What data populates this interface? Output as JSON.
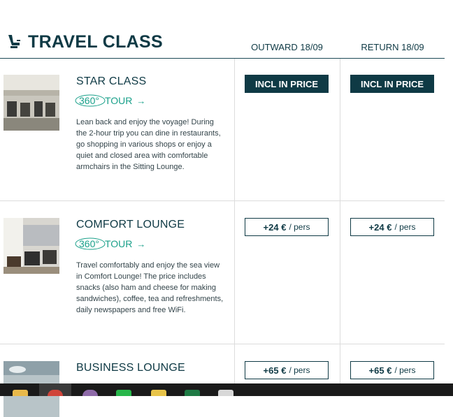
{
  "header": {
    "title": "TRAVEL CLASS",
    "outward_label": "OUTWARD 18/09",
    "return_label": "RETURN 18/09"
  },
  "tour": {
    "badge": "360°",
    "label": "TOUR",
    "arrow": "→"
  },
  "classes": [
    {
      "name": "STAR CLASS",
      "description": "Lean back and enjoy the voyage! During the 2-hour trip you can dine in restaurants, go shopping in various shops or enjoy a quiet and closed area with comfortable armchairs in the Sitting Lounge.",
      "outward_price": "INCL IN PRICE",
      "return_price": "INCL IN PRICE"
    },
    {
      "name": "COMFORT LOUNGE",
      "description": "Travel comfortably and enjoy the sea view in Comfort Lounge! The price includes snacks (also ham and cheese for making sandwiches), coffee, tea and refreshments, daily newspapers and free WiFi.",
      "outward_amount": "+24 €",
      "outward_unit": "/ pers",
      "return_amount": "+24 €",
      "return_unit": "/ pers"
    },
    {
      "name": "BUSINESS LOUNGE",
      "outward_amount": "+65 €",
      "outward_unit": "/ pers",
      "return_amount": "+65 €",
      "return_unit": "/ pers"
    }
  ],
  "colors": {
    "primary": "#0f3a45",
    "accent": "#1aa08a",
    "divider": "#dcdcdc"
  },
  "taskbar": {
    "icons": [
      "file-explorer-icon",
      "chrome-icon",
      "app-icon",
      "line-icon",
      "app-icon-2",
      "excel-icon",
      "notepad-icon"
    ]
  }
}
